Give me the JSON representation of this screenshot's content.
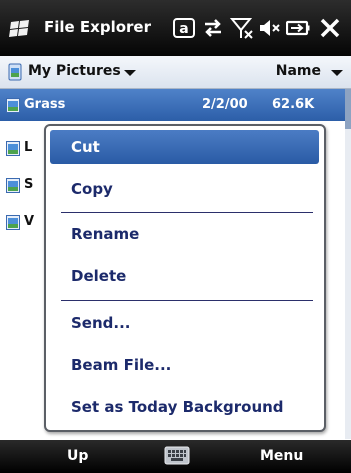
{
  "title_bar": {
    "app_title": "File Explorer",
    "icons": [
      "windows-logo-icon",
      "adaptive-key-icon",
      "connectivity-icon",
      "no-signal-icon",
      "mute-volume-icon",
      "battery-charging-icon",
      "close-icon"
    ]
  },
  "nav_bar": {
    "folder": "My Pictures",
    "sort_by": "Name"
  },
  "files": [
    {
      "name": "Grass",
      "date": "2/2/00",
      "size": "62.6K",
      "selected": true
    },
    {
      "peek": "L"
    },
    {
      "peek": "S"
    },
    {
      "peek": "V"
    }
  ],
  "context_menu": {
    "items": [
      "Cut",
      "Copy",
      "Rename",
      "Delete",
      "Send...",
      "Beam File...",
      "Set as Today Background"
    ],
    "highlighted": "Cut"
  },
  "bottom_bar": {
    "left_softkey": "Up",
    "right_softkey": "Menu"
  },
  "colors": {
    "selection": "#2c5ea8",
    "menu_text": "#1c2a6b",
    "title_bar": "#050505"
  }
}
